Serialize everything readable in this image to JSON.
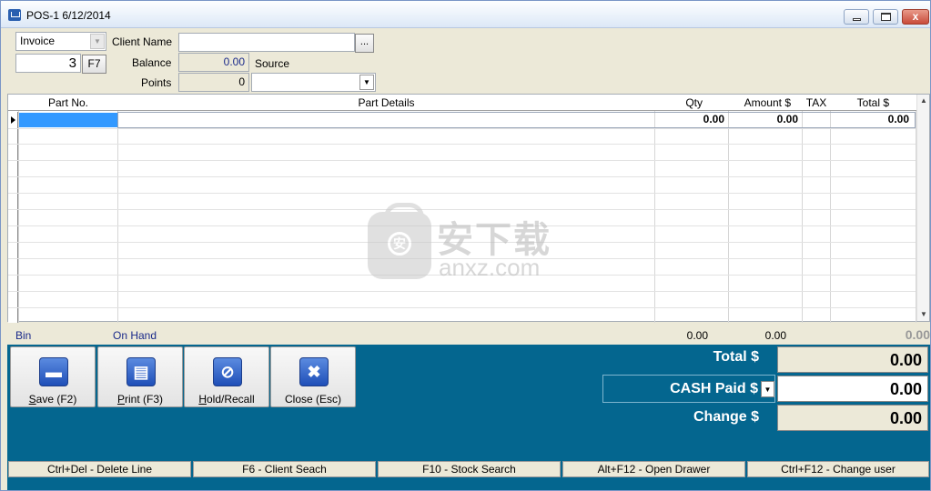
{
  "window": {
    "title": "POS-1   6/12/2014",
    "min_glyph": "",
    "close_glyph": "x"
  },
  "header": {
    "doc_type": "Invoice",
    "doc_number": "3",
    "f7_label": "F7",
    "client_name_label": "Client Name",
    "client_name_value": "",
    "browse_label": "...",
    "balance_label": "Balance",
    "balance_value": "0.00",
    "source_label": "Source",
    "points_label": "Points",
    "points_value": "0",
    "source_value": ""
  },
  "grid": {
    "columns": [
      "Part No.",
      "Part Details",
      "Qty",
      "Amount $",
      "TAX",
      "Total $"
    ],
    "rows": [
      {
        "part_no": "",
        "part_details": "",
        "qty": "0.00",
        "amount": "0.00",
        "tax": "",
        "total": "0.00"
      }
    ]
  },
  "totals_strip": {
    "bin_label": "Bin",
    "on_hand_label": "On Hand",
    "qty_total": "0.00",
    "amount_total": "0.00",
    "grand_total": "0.00"
  },
  "actions": {
    "save": {
      "pre": "",
      "key": "S",
      "post": "ave (F2)"
    },
    "print": {
      "pre": "",
      "key": "P",
      "post": "rint (F3)"
    },
    "hold": {
      "pre": "",
      "key": "H",
      "post": "old/Recall"
    },
    "close": {
      "pre": "",
      "key": "",
      "post": "Close (Esc)"
    }
  },
  "payment": {
    "total_label": "Total $",
    "total_value": "0.00",
    "cash_label": "CASH Paid $",
    "cash_value": "0.00",
    "change_label": "Change $",
    "change_value": "0.00"
  },
  "statusbar": [
    "Ctrl+Del  - Delete Line",
    "F6 - Client Seach",
    "F10 - Stock Search",
    "Alt+F12 - Open Drawer",
    "Ctrl+F12 - Change user"
  ],
  "watermark": {
    "cn": "安下载",
    "en": "anxz.com"
  },
  "icons": {
    "app": "shopping-cart-icon",
    "save": "card-icon",
    "print": "printer-icon",
    "hold": "paperclip-icon",
    "close": "x-icon"
  }
}
